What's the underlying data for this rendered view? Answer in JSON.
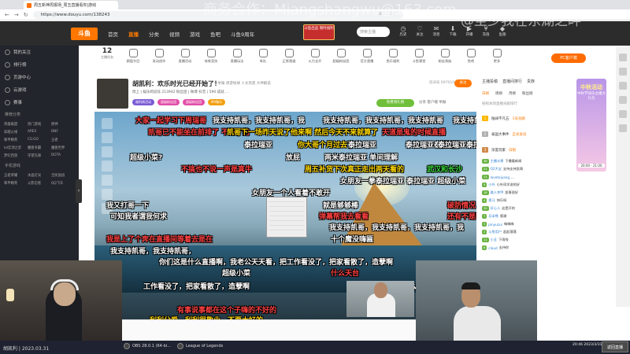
{
  "browser": {
    "tab_title": "周五新神周报场_周五直播看你|游戏",
    "url": "https://www.douyu.com/138243"
  },
  "watermark": {
    "text": "商务合作：Miangshangwu@163.com",
    "overlay": "@至少我在东湖之畔"
  },
  "site": {
    "logo": "斗鱼",
    "nav": [
      "首页",
      "直播",
      "分类",
      "视频",
      "游戏",
      "鱼吧",
      "斗鱼9周年"
    ],
    "promo": "斗鱼出品 限时福利",
    "search_placeholder": "搜索主播",
    "header_icons": [
      "历史",
      "关注",
      "消息",
      "下载",
      "开播",
      "充值",
      "鱼翅"
    ]
  },
  "sidebar": {
    "items": [
      "我的关注",
      "排行榜",
      "页游中心",
      "云游戏",
      "赛事"
    ],
    "section": "推荐分类",
    "games": [
      "英雄联盟",
      "热门游戏",
      "原神",
      "穿越火线",
      "APEX",
      "DNF",
      "和平精英",
      "CS:GO",
      "王者",
      "lol云顶之弈",
      "魔兽争霸",
      "魔兽世界",
      "梦幻西游",
      "守望先锋",
      "DOTA"
    ],
    "section2": "手机游戏",
    "games2": [
      "王者荣耀",
      "水晶灯光",
      "全民国战",
      "和平精英",
      "火影忍者",
      "QQ飞车"
    ]
  },
  "categories": {
    "count_value": "12",
    "count_label": "主播任务",
    "items": [
      "主播任务",
      "颜值节目",
      "发动创作",
      "直播活动",
      "体育竞技",
      "直播玩法",
      "车队",
      "正常频道",
      "火力全开",
      "超级粉丝团",
      "官方直播",
      "鱼乐福利",
      "斗鱼课堂",
      "粉丝贵族",
      "鱼吧",
      "更多"
    ],
    "pc_button": "PC客户端"
  },
  "room": {
    "title": "胡凯利：欢乐时光已经开始了！",
    "tags": "一举报  周游地球  人文风景  大神解说",
    "meta": "周上 | 娱乐跨段炫  213942  粉丝团  | 微博  抖音  | 590 成就  ...",
    "badges": [
      "福利周活动",
      "超级粉丝团",
      "超级粉丝团",
      "MA聚乐"
    ],
    "room_no": "房间号 6970108",
    "follow": "关注",
    "free_gift": "免费领礼物",
    "actions": "分享  客户端  举报"
  },
  "danmaku": [
    {
      "text": "大家一起学习下周瑞哥",
      "color": "#ff4040"
    },
    {
      "text": "我支持凯哥，我支持凯哥，我",
      "color": "#ffffff"
    },
    {
      "text": "我支持凯哥，我支持凯哥，我支持凯哥",
      "color": "#ffffff"
    },
    {
      "text": "我支持凯哥",
      "color": "#ffffff"
    },
    {
      "text": "凯哥已不能坐在前排了 不行了的",
      "color": "#ff4040"
    },
    {
      "text": "凯哥下一场昨天说了他来啊 然后今天不来就算了",
      "color": "#ffd800"
    },
    {
      "text": "天道是鬼的时候直播",
      "color": "#ff4040"
    },
    {
      "text": "泰拉瑞亚",
      "color": "#ffffff"
    },
    {
      "text": "你大哥个月过去了",
      "color": "#ffd800"
    },
    {
      "text": "泰拉瑞亚",
      "color": "#ffffff"
    },
    {
      "text": "泰拉瑞亚泰拉瑞亚",
      "color": "#ffffff"
    },
    {
      "text": "泰拉瑞亚泰拉瑞亚",
      "color": "#ffffff"
    },
    {
      "text": "超级小菜?",
      "color": "#ffffff"
    },
    {
      "text": "放屁",
      "color": "#ffffff"
    },
    {
      "text": "两米泰拉瑞亚 单间理解",
      "color": "#ffffff"
    },
    {
      "text": "不搞也不说一声是真牛",
      "color": "#ff4040"
    },
    {
      "text": "周五补货下次真正走出两天看的",
      "color": "#ffd800"
    },
    {
      "text": "武汉和长沙",
      "color": "#39d839"
    },
    {
      "text": "女朋友一个人看着不敢开",
      "color": "#ffffff"
    },
    {
      "text": "女朋友一拳泰拉瑞亚 泰拉瑞亚 超级小菜",
      "color": "#ffffff"
    },
    {
      "text": "我又打哥一下",
      "color": "#ffffff"
    },
    {
      "text": "就是够够棒",
      "color": "#ffffff"
    },
    {
      "text": "破防情况",
      "color": "#ff4040"
    },
    {
      "text": "弹幕帮我去看看",
      "color": "#ff4040"
    },
    {
      "text": "还有不是啊",
      "color": "#ff4040"
    },
    {
      "text": "可知我者谓我何求",
      "color": "#ffffff"
    },
    {
      "text": "我支持凯哥，我支持凯哥，我支持凯哥，我",
      "color": "#ffffff"
    },
    {
      "text": "我是上了个奔在直播间等着去是在",
      "color": "#ff4040"
    },
    {
      "text": "十个魔没嗨匾",
      "color": "#ffffff"
    },
    {
      "text": "我支持凯哥，我支持凯哥，",
      "color": "#ffffff"
    },
    {
      "text": "你们这是什么直播啊，我老公天天看，把工作看没了，把家看散了，造孽啊",
      "color": "#ffffff"
    },
    {
      "text": "超级小菜",
      "color": "#ffffff"
    },
    {
      "text": "什么天台",
      "color": "#ff4040"
    },
    {
      "text": "工作看没了，把家看散了，造孽啊",
      "color": "#ffffff"
    },
    {
      "text": "你们这是什么",
      "color": "#ffffff"
    },
    {
      "text": "有事说事都在这个子嗨的不好的",
      "color": "#ff4040"
    },
    {
      "text": "利利分爱，利利很敬业，不要太好的",
      "color": "#ffd800"
    }
  ],
  "right_panel": {
    "tabs": [
      "主播投稿",
      "直播间排行",
      "贵族"
    ],
    "rank_tabs": [
      "日榜",
      "周榜",
      "月榜",
      "粉丝榜"
    ],
    "rank_note": "按照本场直播贡献排行",
    "rank": [
      {
        "n": "1",
        "name": "陆阔不凡五",
        "val": "1号贡献"
      },
      {
        "n": "2",
        "name": "泰国大事件",
        "val": "正式会员"
      },
      {
        "n": "3",
        "name": "深度玩家",
        "val": "白银"
      }
    ],
    "chat": [
      {
        "lv": "38",
        "user": "主播水果",
        "msg": "下播看新闻"
      },
      {
        "lv": "21",
        "user": "Q2大宝",
        "msg": "支持支持凯哥"
      },
      {
        "lv": "11",
        "user": "lovetaiyang",
        "msg": "..."
      },
      {
        "lv": "9",
        "user": "小外",
        "msg": "小外同学说的好"
      },
      {
        "lv": "16",
        "user": "路人李甲",
        "msg": "凯哥很好"
      },
      {
        "lv": "4",
        "user": "奥马",
        "msg": "快乐呀"
      },
      {
        "lv": "30",
        "user": "好心人",
        "msg": "这是开的"
      },
      {
        "lv": "7",
        "user": "月半熊",
        "msg": "感谢"
      },
      {
        "lv": "5",
        "user": "pinyuzui",
        "msg": "嗨嗨嗨"
      },
      {
        "lv": "2",
        "user": "斗鱼用户",
        "msg": "起起落落"
      },
      {
        "lv": "12",
        "user": "小丑",
        "msg": "下雨啦"
      },
      {
        "lv": "6",
        "user": "cloud",
        "msg": "支持你"
      }
    ],
    "ad": {
      "title": "中秋活动",
      "sub": "中秋节快乐主播大礼包",
      "time": "20:00 - 21:00"
    }
  },
  "taskbar": {
    "apps": [
      "OBS 28.0.1 (64-bi...",
      "League of Legends"
    ],
    "datestamp": "胡凯利 | 2023.03.31",
    "clock": "20:46 2023/3/31",
    "back_live": "返回直播"
  }
}
